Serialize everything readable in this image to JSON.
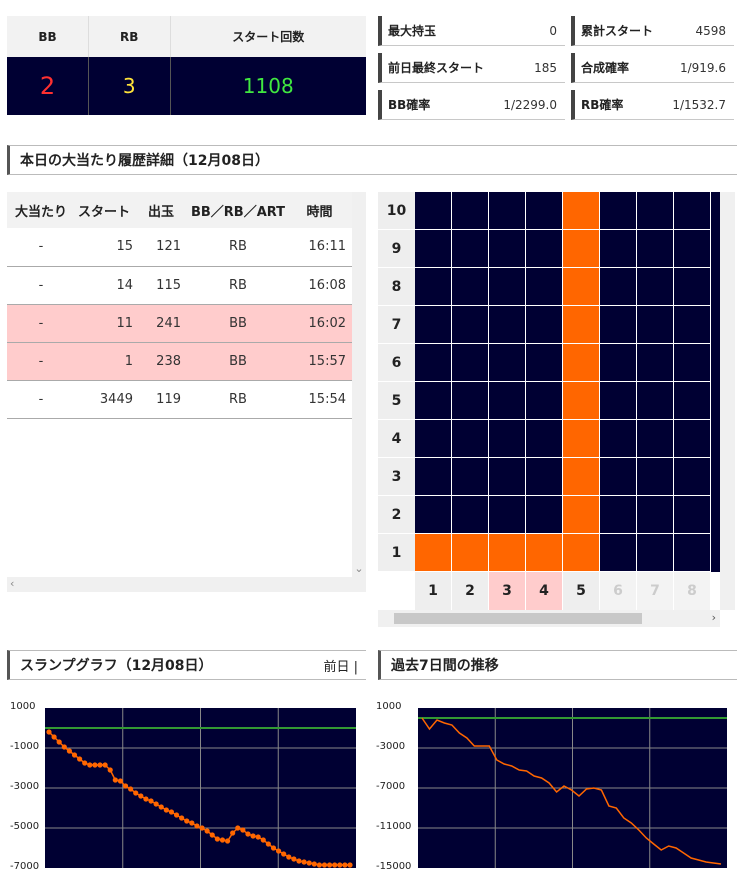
{
  "summary": {
    "headers": {
      "bb": "BB",
      "rb": "RB",
      "start": "スタート回数"
    },
    "values": {
      "bb": "2",
      "rb": "3",
      "start": "1108"
    }
  },
  "stats": [
    {
      "label": "最大持玉",
      "value": "0"
    },
    {
      "label": "累計スタート",
      "value": "4598"
    },
    {
      "label": "前日最終スタート",
      "value": "185"
    },
    {
      "label": "合成確率",
      "value": "1/919.6"
    },
    {
      "label": "BB確率",
      "value": "1/2299.0"
    },
    {
      "label": "RB確率",
      "value": "1/1532.7"
    }
  ],
  "history": {
    "title": "本日の大当たり履歴詳細（12月08日）",
    "columns": [
      "大当たり",
      "スタート",
      "出玉",
      "BB／RB／ART",
      "時間"
    ],
    "rows": [
      {
        "hit": "-",
        "start": "15",
        "out": "121",
        "type": "RB",
        "time": "16:11"
      },
      {
        "hit": "-",
        "start": "14",
        "out": "115",
        "type": "RB",
        "time": "16:08"
      },
      {
        "hit": "-",
        "start": "11",
        "out": "241",
        "type": "BB",
        "time": "16:02"
      },
      {
        "hit": "-",
        "start": "1",
        "out": "238",
        "type": "BB",
        "time": "15:57"
      },
      {
        "hit": "-",
        "start": "3449",
        "out": "119",
        "type": "RB",
        "time": "15:54"
      }
    ]
  },
  "day_grid": {
    "y_labels": [
      "10",
      "9",
      "8",
      "7",
      "6",
      "5",
      "4",
      "3",
      "2",
      "1"
    ],
    "x_labels": [
      "1",
      "2",
      "3",
      "4",
      "5",
      "6",
      "7",
      "8"
    ],
    "levels": [
      1,
      1,
      1,
      1,
      10,
      0,
      0,
      0
    ],
    "highlighted_days": [
      "3",
      "4"
    ],
    "dim_days": [
      "6",
      "7",
      "8"
    ],
    "colors": {
      "filled": "#ff6600",
      "empty": "#000033"
    }
  },
  "slump": {
    "title": "スランプグラフ（12月08日）",
    "nav": "前日 |"
  },
  "trend": {
    "title": "過去7日間の推移"
  },
  "chart_data": [
    {
      "type": "line",
      "ylim": [
        -7000,
        1000
      ],
      "yticks": [
        "1000",
        "-1000",
        "-3000",
        "-5000",
        "-7000"
      ],
      "baseline": 0,
      "markers": true,
      "x": [
        0,
        1,
        2,
        3,
        4,
        5,
        6,
        7,
        8,
        9,
        10,
        11,
        12,
        13,
        14,
        15,
        16,
        17,
        18,
        19,
        20,
        21,
        22,
        23,
        24,
        25,
        26,
        27,
        28,
        29,
        30,
        31,
        32,
        33,
        34,
        35,
        36,
        37,
        38,
        39,
        40,
        41,
        42,
        43,
        44,
        45,
        46,
        47,
        48,
        49,
        50,
        51,
        52,
        53,
        54,
        55,
        56,
        57,
        58,
        59
      ],
      "values": [
        -200,
        -450,
        -700,
        -950,
        -1150,
        -1350,
        -1550,
        -1750,
        -1850,
        -1850,
        -1850,
        -1850,
        -2100,
        -2600,
        -2650,
        -2900,
        -3050,
        -3250,
        -3400,
        -3550,
        -3650,
        -3800,
        -3950,
        -4100,
        -4200,
        -4350,
        -4500,
        -4650,
        -4750,
        -4900,
        -5000,
        -5150,
        -5350,
        -5550,
        -5600,
        -5650,
        -5250,
        -5000,
        -5100,
        -5300,
        -5400,
        -5450,
        -5600,
        -5800,
        -6000,
        -6150,
        -6300,
        -6450,
        -6550,
        -6650,
        -6700,
        -6750,
        -6800,
        -6850,
        -6850,
        -6850,
        -6850,
        -6850,
        -6850,
        -6850
      ],
      "series_color": "#ff6600",
      "baseline_color": "#339933"
    },
    {
      "type": "line",
      "ylim": [
        -15000,
        1000
      ],
      "yticks": [
        "1000",
        "-3000",
        "-7000",
        "-11000",
        "-15000"
      ],
      "baseline": 0,
      "markers": false,
      "x": [
        0,
        1,
        2,
        3,
        4,
        5,
        6,
        7,
        8,
        9,
        10,
        11,
        12,
        13,
        14,
        15,
        16,
        17,
        18,
        19,
        20,
        21,
        22,
        23,
        24,
        25,
        26,
        27,
        28,
        29,
        30,
        31,
        32,
        33,
        34,
        35,
        36,
        37,
        38,
        39,
        40
      ],
      "values": [
        0,
        -1100,
        -200,
        -500,
        -700,
        -1500,
        -2000,
        -2800,
        -2800,
        -2800,
        -4200,
        -4600,
        -4800,
        -5200,
        -5300,
        -5800,
        -6000,
        -6500,
        -7400,
        -6800,
        -7200,
        -7800,
        -7100,
        -7000,
        -7200,
        -8800,
        -9000,
        -10000,
        -10500,
        -11200,
        -12000,
        -12600,
        -13200,
        -12800,
        -13000,
        -13500,
        -14000,
        -14200,
        -14400,
        -14500,
        -14600
      ],
      "series_color": "#ff6600",
      "baseline_color": "#339933"
    }
  ]
}
